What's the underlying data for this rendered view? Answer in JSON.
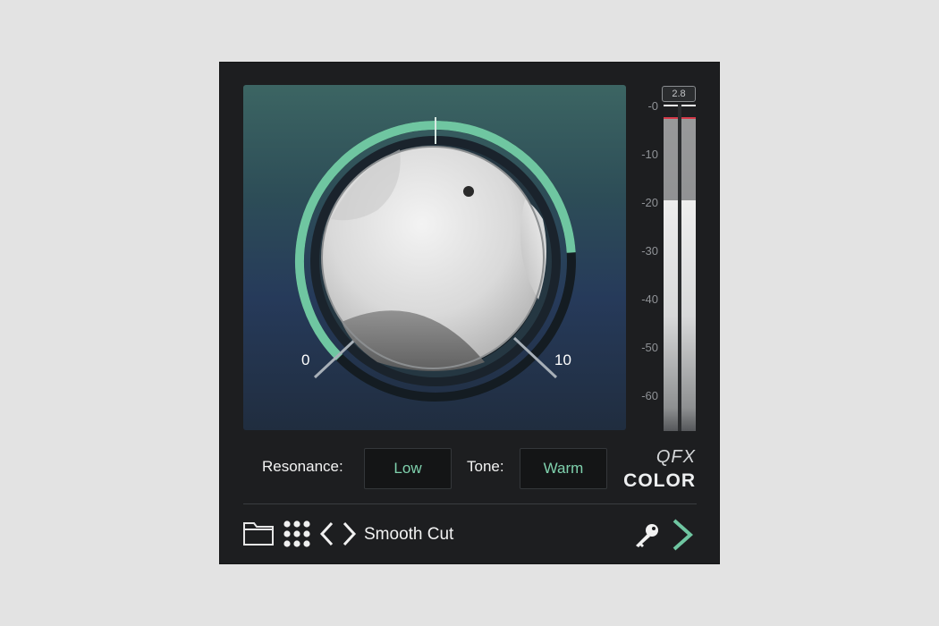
{
  "knob": {
    "min_label": "0",
    "max_label": "10",
    "value_fraction": 0.82,
    "arc_color": "#6fc6a1"
  },
  "meter": {
    "readout": "2.8",
    "ticks": [
      "-0",
      "-10",
      "-20",
      "-30",
      "-40",
      "-50",
      "-60"
    ],
    "level_db": -20,
    "peak_color": "#d63a4a"
  },
  "controls": {
    "resonance_label": "Resonance:",
    "resonance_value": "Low",
    "tone_label": "Tone:",
    "tone_value": "Warm"
  },
  "brand": {
    "line1": "QFX",
    "line2": "COLOR"
  },
  "toolbar": {
    "folder_icon": "folder-icon",
    "grid_icon": "grid-icon",
    "prev_icon": "chevron-left-icon",
    "next_icon": "chevron-right-icon",
    "preset_name": "Smooth Cut",
    "key_icon": "key-icon",
    "forward_icon": "forward-chevron-icon"
  },
  "colors": {
    "accent": "#6fc6a1",
    "panel_bg": "#1d1e20"
  }
}
